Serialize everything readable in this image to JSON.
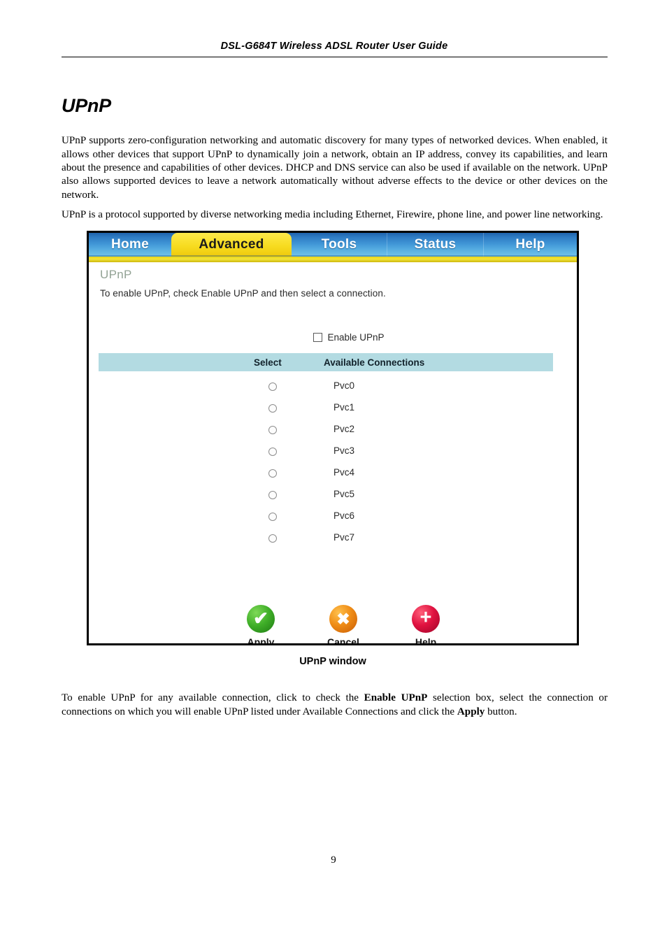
{
  "document": {
    "running_header": "DSL-G684T Wireless ADSL Router User Guide",
    "section_title": "UPnP",
    "page_number": "9",
    "paragraph_1": "UPnP supports zero-configuration networking and automatic discovery for many types of networked devices. When enabled, it allows other devices that support UPnP to dynamically join a network, obtain an IP address, convey its capabilities, and learn about the presence and capabilities of other devices. DHCP and DNS service can also be used if available on the network. UPnP also allows supported devices to leave a network automatically without adverse effects to the device or other devices on the network.",
    "paragraph_2": "UPnP is a protocol supported by diverse networking media including Ethernet, Firewire, phone line, and power line networking.",
    "figure_caption": "UPnP window",
    "paragraph_3": {
      "part_1": "To enable UPnP for any available connection, click to check the ",
      "bold_1": "Enable UPnP",
      "part_2": " selection box, select the connection or connections on which you will enable UPnP listed under Available Connections and click the ",
      "bold_2": "Apply",
      "part_3": " button."
    }
  },
  "router_ui": {
    "nav_tabs": [
      {
        "label": "Home",
        "active": false
      },
      {
        "label": "Advanced",
        "active": true
      },
      {
        "label": "Tools",
        "active": false
      },
      {
        "label": "Status",
        "active": false
      },
      {
        "label": "Help",
        "active": false
      }
    ],
    "panel": {
      "title": "UPnP",
      "instructions": "To enable UPnP, check Enable UPnP and then select a connection."
    },
    "enable_upnp": {
      "label": "Enable UPnP",
      "checked": false
    },
    "table": {
      "headers": {
        "select": "Select",
        "available_connections": "Available Connections"
      },
      "rows": [
        {
          "name": "Pvc0",
          "selected": false
        },
        {
          "name": "Pvc1",
          "selected": false
        },
        {
          "name": "Pvc2",
          "selected": false
        },
        {
          "name": "Pvc3",
          "selected": false
        },
        {
          "name": "Pvc4",
          "selected": false
        },
        {
          "name": "Pvc5",
          "selected": false
        },
        {
          "name": "Pvc6",
          "selected": false
        },
        {
          "name": "Pvc7",
          "selected": false
        }
      ]
    },
    "buttons": [
      {
        "label": "Apply",
        "icon": "check-circle-icon",
        "glyph": "✔",
        "color": "#3fae28"
      },
      {
        "label": "Cancel",
        "icon": "cross-circle-icon",
        "glyph": "✖",
        "color": "#ef8c16"
      },
      {
        "label": "Help",
        "icon": "plus-circle-icon",
        "glyph": "+",
        "color": "#e01240"
      }
    ],
    "colors": {
      "navbar_blue": "#3f95d6",
      "active_tab_yellow": "#f7dc20",
      "table_header_teal": "#b3dbe2",
      "panel_title_gray": "#93a395"
    }
  }
}
